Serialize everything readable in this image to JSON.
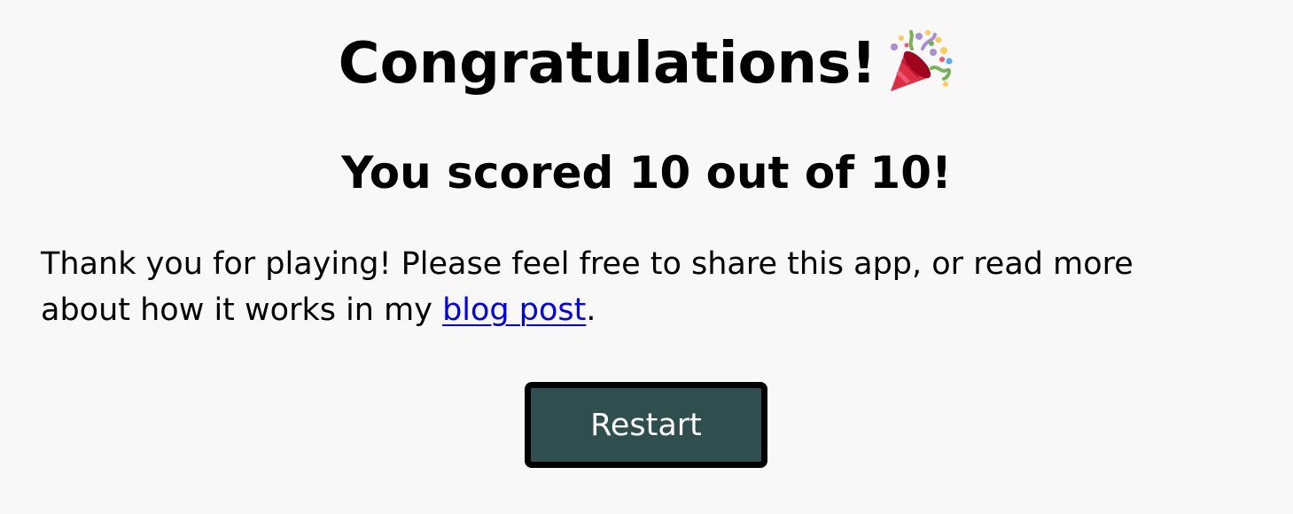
{
  "result": {
    "title": "Congratulations!",
    "title_icon": "party-popper-icon",
    "score_text": "You scored 10 out of 10!"
  },
  "message": {
    "text_before": "Thank you for playing! Please feel free to share this app, or read more about how it works in my ",
    "link_text": "blog post",
    "text_after": "."
  },
  "actions": {
    "restart_label": "Restart"
  },
  "colors": {
    "background": "#f8f8f8",
    "button_background": "#2f4f4f",
    "button_border": "#000000",
    "link": "#0000ee"
  }
}
